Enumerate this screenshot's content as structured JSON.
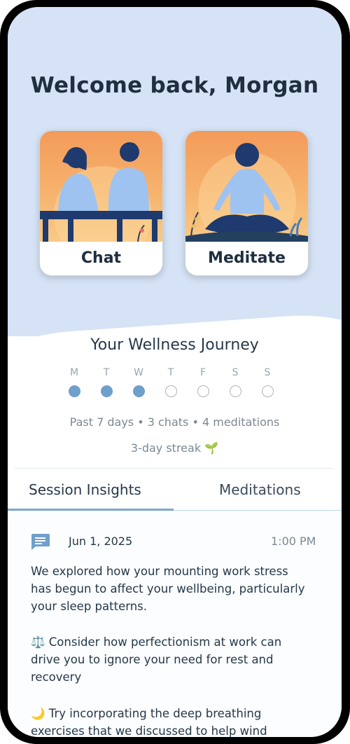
{
  "header": {
    "welcome": "Welcome back, Morgan"
  },
  "cards": [
    {
      "label": "Chat",
      "icon": "two-people-on-bench-illustration"
    },
    {
      "label": "Meditate",
      "icon": "meditating-person-illustration"
    }
  ],
  "journey": {
    "title": "Your Wellness Journey",
    "days": [
      {
        "label": "M",
        "done": true
      },
      {
        "label": "T",
        "done": true
      },
      {
        "label": "W",
        "done": true
      },
      {
        "label": "T",
        "done": false
      },
      {
        "label": "F",
        "done": false
      },
      {
        "label": "S",
        "done": false
      },
      {
        "label": "S",
        "done": false
      }
    ],
    "stats": "Past 7 days • 3 chats • 4 meditations",
    "streak": "3-day streak 🌱"
  },
  "tabs": [
    {
      "label": "Session Insights",
      "active": true
    },
    {
      "label": "Meditations",
      "active": false
    }
  ],
  "session": {
    "icon": "chat-bubble-icon",
    "date": "Jun 1, 2025",
    "time": "1:00 PM",
    "paragraphs": [
      "We explored how your mounting work stress has begun to affect your wellbeing, particularly your sleep patterns.",
      "⚖️ Consider how perfectionism at work can drive you to ignore your need for rest and recovery",
      "🌙 Try incorporating the deep breathing exercises that we discussed to help wind"
    ]
  },
  "colors": {
    "hero_bg": "#d6e3f6",
    "accent": "#6f9fcb",
    "text": "#26384a"
  }
}
